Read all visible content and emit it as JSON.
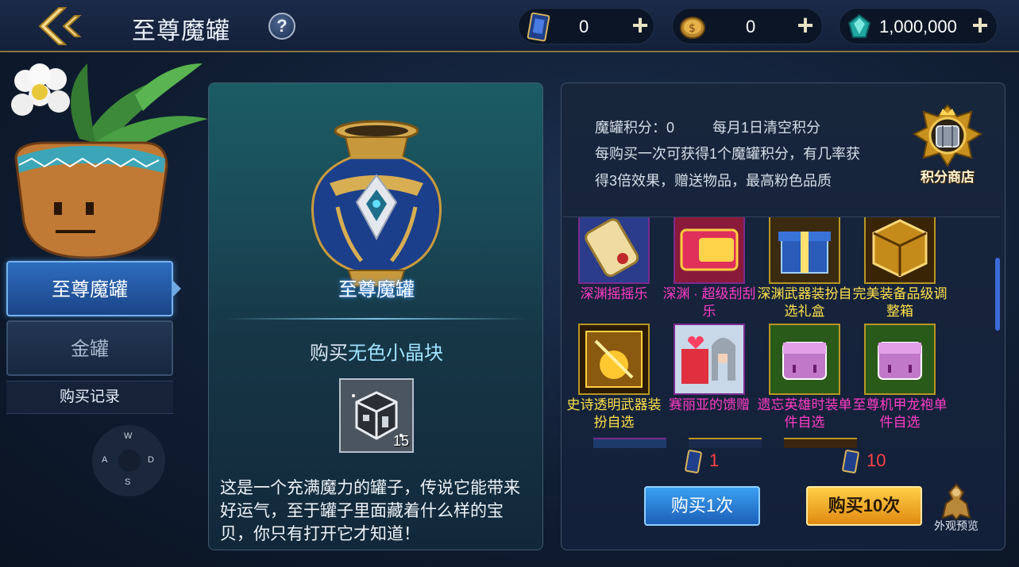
{
  "header": {
    "title": "至尊魔罐",
    "help": "?",
    "currencies": [
      {
        "icon": "card-ticket-icon",
        "value": "0"
      },
      {
        "icon": "gold-coin-icon",
        "value": "0"
      },
      {
        "icon": "gem-icon",
        "value": "1,000,000"
      }
    ],
    "plus": "+"
  },
  "sidebar": {
    "tabs": [
      {
        "label": "至尊魔罐",
        "selected": true
      },
      {
        "label": "金罐",
        "selected": false
      }
    ],
    "record_label": "购买记录",
    "dpad": {
      "up": "W",
      "left": "A",
      "right": "D",
      "down": "S"
    }
  },
  "main": {
    "jar_name": "至尊魔罐",
    "buy_prefix": "购买",
    "buy_item": "无色小晶块",
    "item_count": "15",
    "description": "这是一个充满魔力的罐子，传说它能带来好运气，至于罐子里面藏着什么样的宝贝，你只有打开它才知道！"
  },
  "rewards": {
    "points_label": "魔罐积分：0",
    "points_clear": "每月1日清空积分",
    "rule": "每购买一次可获得1个魔罐积分，有几率获得3倍效果，赠送物品，最高粉色品质",
    "shop_label": "积分商店",
    "items": [
      {
        "name": "深渊摇摇乐",
        "color": "pink",
        "icon": "scroll-icon"
      },
      {
        "name": "深渊 · 超级刮刮乐",
        "color": "pink",
        "icon": "scratch-card-icon"
      },
      {
        "name": "深渊武器装扮自选礼盒",
        "color": "yellow",
        "icon": "gift-box-icon"
      },
      {
        "name": "完美装备品级调整箱",
        "color": "yellow",
        "icon": "adjust-box-icon"
      },
      {
        "name": "史诗透明武器装扮自选",
        "color": "yellow",
        "icon": "epic-weapon-icon"
      },
      {
        "name": "赛丽亚的馈赠",
        "color": "pink",
        "icon": "seria-gift-icon"
      },
      {
        "name": "遗忘英雄时装单件自选",
        "color": "pink",
        "icon": "avatar-box-icon"
      },
      {
        "name": "至尊机甲龙袍单件自选",
        "color": "pink",
        "icon": "avatar-box-icon"
      }
    ],
    "cost_one": "1",
    "cost_ten": "10",
    "buy_one_label": "购买1次",
    "buy_ten_label": "购买10次",
    "preview_label": "外观预览"
  },
  "colors": {
    "accent_blue": "#2e6dbf",
    "accent_gold": "#f0a821",
    "rarity_pink": "#ff3cc7",
    "rarity_yellow": "#ffe14a",
    "cost_red": "#ff4242"
  }
}
